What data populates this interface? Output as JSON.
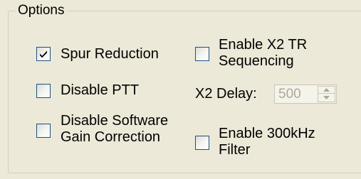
{
  "group": {
    "title": "Options"
  },
  "options": {
    "spur_reduction": {
      "label": "Spur Reduction",
      "checked": true
    },
    "disable_ptt": {
      "label": "Disable PTT",
      "checked": false
    },
    "disable_software_gain": {
      "label_line1": "Disable Software",
      "label_line2": "Gain Correction",
      "checked": false
    },
    "enable_x2_tr": {
      "label_line1": "Enable X2 TR",
      "label_line2": "Sequencing",
      "checked": false
    },
    "x2_delay": {
      "label": "X2 Delay:",
      "value": "500",
      "enabled": false
    },
    "enable_300khz": {
      "label_line1": "Enable 300kHz",
      "label_line2": "Filter",
      "checked": false
    }
  },
  "colors": {
    "background": "#ECE9D8",
    "checkbox_border": "#1C5180",
    "checkmark": "#21A121",
    "disabled_text": "#ACA899"
  },
  "icons": {
    "checkmark": "check-icon",
    "spin_up": "arrow-up-icon",
    "spin_down": "arrow-down-icon"
  }
}
